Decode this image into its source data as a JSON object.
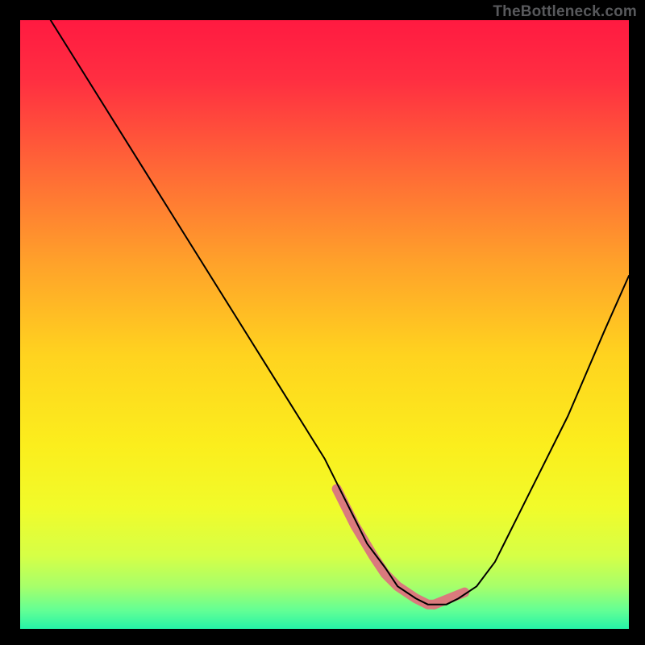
{
  "watermark": "TheBottleneck.com",
  "chart_data": {
    "type": "line",
    "title": "",
    "xlabel": "",
    "ylabel": "",
    "xlim": [
      0,
      100
    ],
    "ylim": [
      0,
      100
    ],
    "x": [
      0,
      5,
      10,
      15,
      20,
      25,
      30,
      35,
      40,
      45,
      50,
      53,
      55,
      57,
      60,
      62,
      65,
      67,
      68,
      70,
      72,
      75,
      78,
      80,
      83,
      86,
      90,
      93,
      96,
      100
    ],
    "y": [
      110,
      100,
      92,
      84,
      76,
      68,
      60,
      52,
      44,
      36,
      28,
      22,
      18,
      14,
      10,
      7,
      5,
      4,
      4,
      4,
      5,
      7,
      11,
      15,
      21,
      27,
      35,
      42,
      49,
      58
    ],
    "background": {
      "type": "vertical-gradient",
      "stops": [
        {
          "offset": 0.0,
          "color": "#ff1a41"
        },
        {
          "offset": 0.1,
          "color": "#ff2f41"
        },
        {
          "offset": 0.25,
          "color": "#ff6a36"
        },
        {
          "offset": 0.4,
          "color": "#ffa22a"
        },
        {
          "offset": 0.55,
          "color": "#ffd31f"
        },
        {
          "offset": 0.7,
          "color": "#fbee1d"
        },
        {
          "offset": 0.8,
          "color": "#f1fb2a"
        },
        {
          "offset": 0.88,
          "color": "#d6ff46"
        },
        {
          "offset": 0.93,
          "color": "#a7ff6a"
        },
        {
          "offset": 0.97,
          "color": "#62ff95"
        },
        {
          "offset": 1.0,
          "color": "#25f3a7"
        }
      ]
    },
    "series": [
      {
        "name": "curve",
        "color": "#000000",
        "stroke_width": 2
      },
      {
        "name": "near-zero-highlight",
        "color": "#da7a7d",
        "stroke_width": 12,
        "segments": [
          {
            "x": [
              52,
              55,
              58,
              60,
              62,
              65,
              67,
              68
            ],
            "y": [
              23,
              17,
              12,
              9,
              7,
              5,
              4,
              4
            ]
          },
          {
            "x": [
              68,
              73
            ],
            "y": [
              4,
              6
            ]
          }
        ]
      }
    ]
  }
}
